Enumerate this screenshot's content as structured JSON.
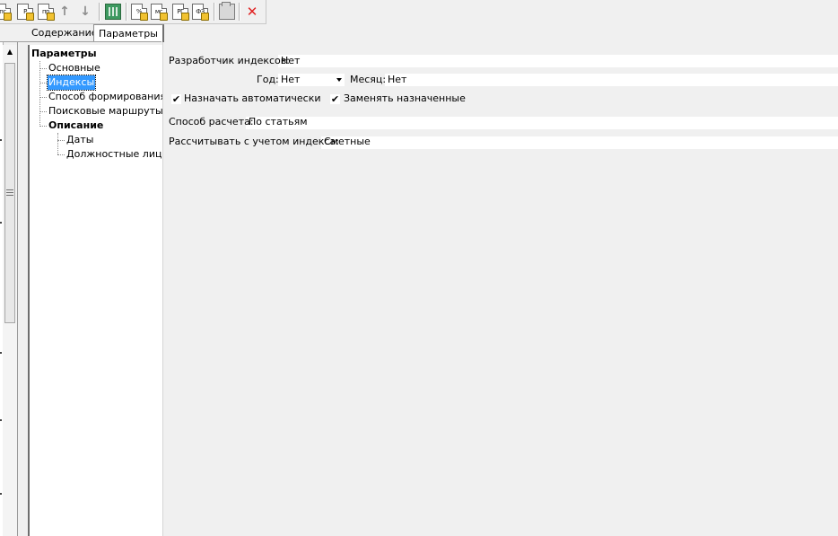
{
  "toolbar": {
    "buttons": [
      {
        "label": "пс",
        "icon": "document-ps-icon"
      },
      {
        "label": "Р",
        "icon": "document-r-icon"
      },
      {
        "label": "пр",
        "icon": "document-pr-icon"
      },
      {
        "icon": "arrow-up-icon"
      },
      {
        "icon": "arrow-down-icon"
      },
      {
        "icon": "calculator-icon"
      },
      {
        "label": "%",
        "icon": "document-percent-icon"
      },
      {
        "label": "мс",
        "icon": "document-mc-icon"
      },
      {
        "label": "РГ",
        "icon": "document-rg-icon"
      },
      {
        "label": "ФЗ",
        "icon": "document-fz-icon"
      },
      {
        "icon": "folder-icon"
      },
      {
        "icon": "close-icon"
      }
    ]
  },
  "tabs": [
    {
      "label": "Содержание",
      "active": false
    },
    {
      "label": "Параметры",
      "active": true
    }
  ],
  "tree": {
    "root": "Параметры",
    "items": [
      {
        "label": "Основные",
        "selected": false
      },
      {
        "label": "Индексы",
        "selected": true
      },
      {
        "label": "Способ формирования",
        "selected": false
      },
      {
        "label": "Поисковые маршруты",
        "selected": false
      },
      {
        "label": "Описание",
        "bold": true,
        "children": [
          "Даты",
          "Должностные лица"
        ]
      }
    ]
  },
  "form": {
    "developer": {
      "label": "Разработчик индексов:",
      "value": "Нет"
    },
    "year": {
      "label": "Год:",
      "value": "Нет"
    },
    "month": {
      "label": "Месяц:",
      "value": "Нет"
    },
    "auto_assign": {
      "label": "Назначать автоматически",
      "checked": true
    },
    "replace_assigned": {
      "label": "Заменять назначенные",
      "checked": true
    },
    "calc_method": {
      "label": "Способ расчета:",
      "value": "По статьям"
    },
    "index_basis": {
      "label": "Рассчитывать с учетом индекса:",
      "value": "Сметные"
    }
  }
}
